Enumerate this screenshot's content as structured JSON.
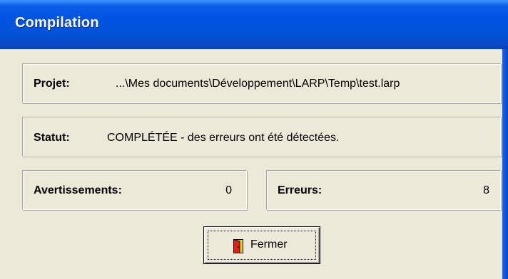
{
  "window": {
    "title": "Compilation"
  },
  "project": {
    "label": "Projet:",
    "value": "...\\Mes documents\\Développement\\LARP\\Temp\\test.larp"
  },
  "status": {
    "label": "Statut:",
    "value": "COMPLÉTÉE - des erreurs ont été détectées."
  },
  "warnings": {
    "label": "Avertissements:",
    "value": "0"
  },
  "errors": {
    "label": "Erreurs:",
    "value": "8"
  },
  "close_button": {
    "label": "Fermer",
    "icon": "door-exit-icon"
  },
  "colors": {
    "titlebar": "#0054e3",
    "dialog_bg": "#ece9d8",
    "icon_red": "#e02010",
    "icon_yellow": "#f8d000"
  }
}
